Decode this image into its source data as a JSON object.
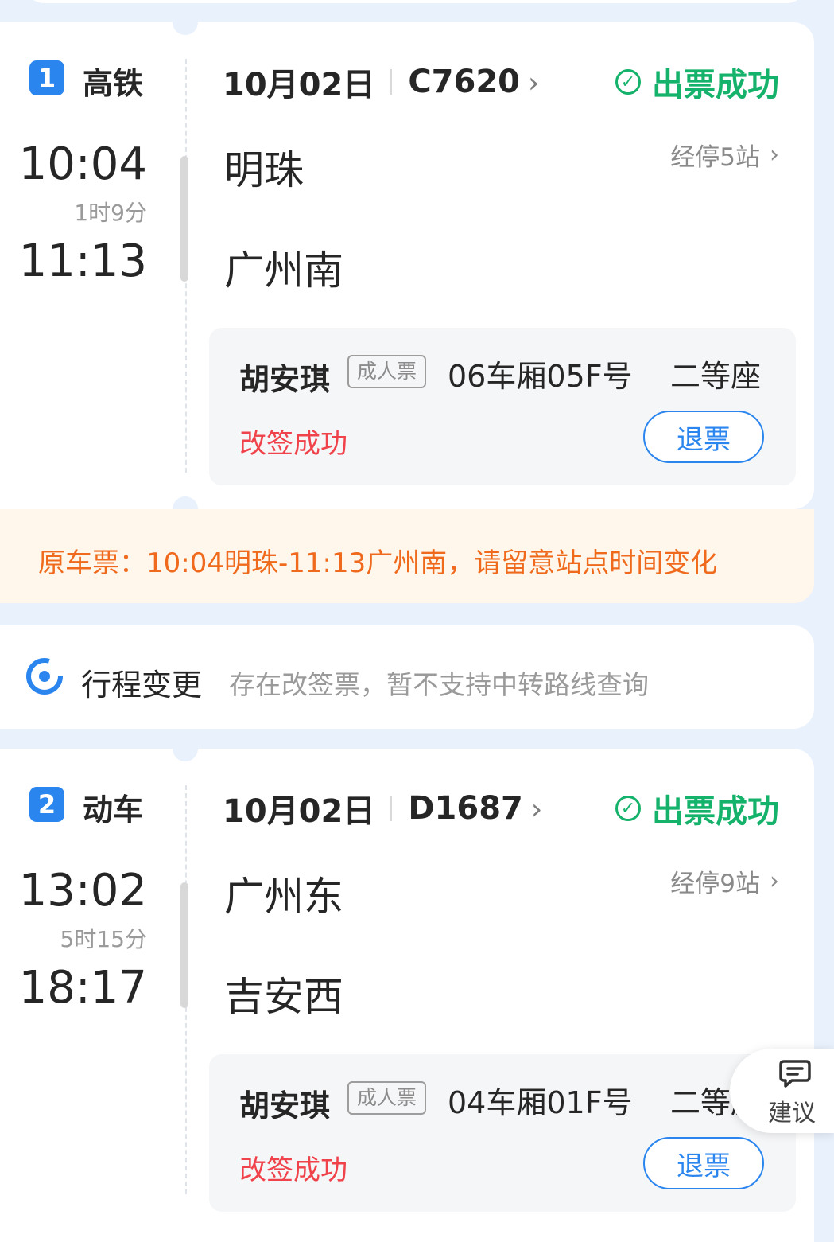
{
  "segments": [
    {
      "index": "1",
      "type": "高铁",
      "depart_time": "10:04",
      "duration": "1时9分",
      "arrive_time": "11:13",
      "date": "10月02日",
      "train_no": "C7620",
      "status": "出票成功",
      "from_station": "明珠",
      "to_station": "广州南",
      "stops": "经停5站",
      "passenger": {
        "name": "胡安琪",
        "ticket_type": "成人票",
        "seat": "06车厢05F号",
        "seat_class": "二等座",
        "change_status": "改签成功",
        "refund_label": "退票"
      }
    },
    {
      "index": "2",
      "type": "动车",
      "depart_time": "13:02",
      "duration": "5时15分",
      "arrive_time": "18:17",
      "date": "10月02日",
      "train_no": "D1687",
      "status": "出票成功",
      "from_station": "广州东",
      "to_station": "吉安西",
      "stops": "经停9站",
      "passenger": {
        "name": "胡安琪",
        "ticket_type": "成人票",
        "seat": "04车厢01F号",
        "seat_class": "二等座",
        "change_status": "改签成功",
        "refund_label": "退票"
      }
    }
  ],
  "notice": "原车票：10:04明珠-11:13广州南，请留意站点时间变化",
  "itinerary_change": {
    "title": "行程变更",
    "description": "存在改签票，暂不支持中转路线查询"
  },
  "suggest_label": "建议",
  "colors": {
    "background": "#e9f1fd",
    "brand_blue": "#2a86ee",
    "success_green": "#14b26a",
    "alert_red": "#f0424a",
    "notice_orange": "#ef6a1c"
  },
  "icons": {
    "status": "check-circle-icon",
    "chevron": "chevron-right-icon",
    "change": "route-change-icon",
    "suggest": "chat-bubble-icon"
  }
}
